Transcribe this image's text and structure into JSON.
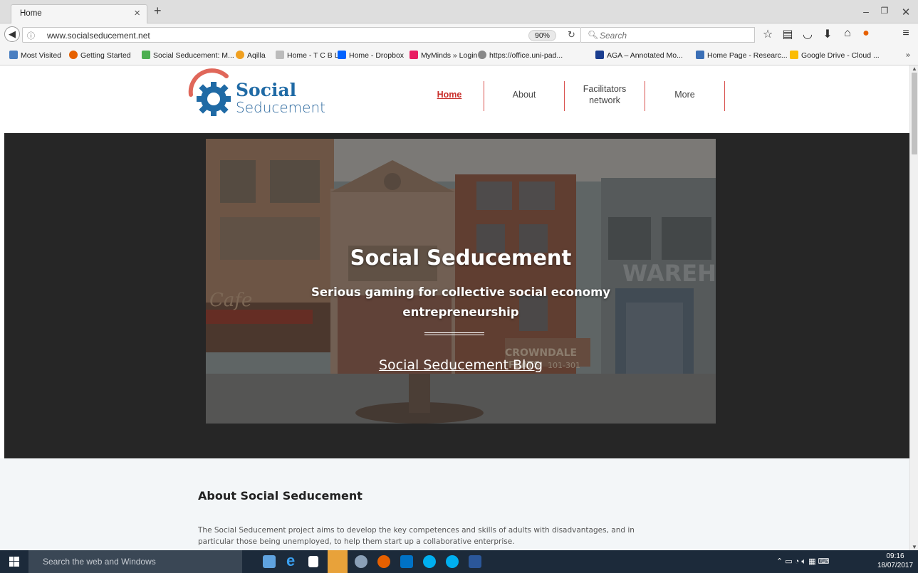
{
  "browser": {
    "tab_title": "Home",
    "url": "www.socialseducement.net",
    "zoom": "90%",
    "search_placeholder": "Search"
  },
  "bookmarks": [
    {
      "label": "Most Visited",
      "color": "#4a7fc1"
    },
    {
      "label": "Getting Started",
      "color": "#e66000"
    },
    {
      "label": "Social Seducement: M...",
      "color": "#4caf50"
    },
    {
      "label": "Aqilla",
      "color": "#f0a020"
    },
    {
      "label": "Home - T C B L",
      "color": "#9e9e9e"
    },
    {
      "label": "Home - Dropbox",
      "color": "#0061fe"
    },
    {
      "label": "MyMinds » Login",
      "color": "#e91e63"
    },
    {
      "label": "https://office.uni-pad...",
      "color": "#888888"
    },
    {
      "label": "AGA – Annotated Mo...",
      "color": "#1a3d8f"
    },
    {
      "label": "Home Page - Researc...",
      "color": "#3b6fb6"
    },
    {
      "label": "Google Drive - Cloud ...",
      "color": "#fbbc04"
    }
  ],
  "site": {
    "logo_line1": "Social",
    "logo_line2": "Seducement",
    "nav": {
      "home": "Home",
      "about": "About",
      "facilitators": "Facilitators network",
      "more": "More"
    },
    "hero": {
      "title": "Social Seducement",
      "subtitle": "Serious gaming for collective social economy entrepreneurship",
      "link": "Social Seducement Blog",
      "img_cafe": "Cafe",
      "img_warehouse": "WAREHOU",
      "img_crowndale": "CROWNDALE",
      "img_flats": "FLATS",
      "img_numbers": "101-301"
    },
    "about": {
      "title": "About Social Seducement",
      "text": "The Social Seducement project aims to develop the key competences and skills of adults with disadvantages, and in particular those being unemployed, to help them start up a collaborative enterprise."
    }
  },
  "taskbar": {
    "search_text": "Search the web and Windows",
    "time": "09:16",
    "date": "18/07/2017"
  },
  "colors": {
    "accent_red": "#d9534f",
    "logo_blue": "#1f6aa5",
    "hero_bg": "#262626"
  }
}
